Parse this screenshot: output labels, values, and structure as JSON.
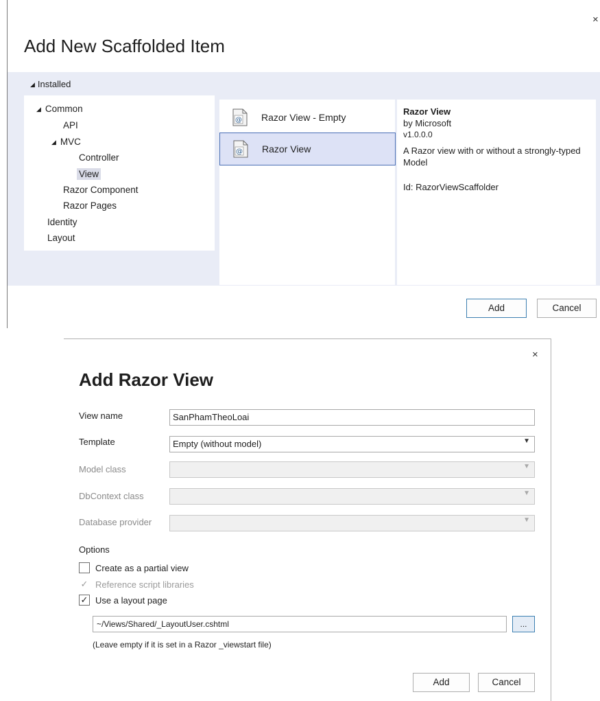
{
  "scaffold": {
    "title": "Add New Scaffolded Item",
    "installed_label": "Installed",
    "tree": [
      {
        "label": "Common"
      },
      {
        "label": "API"
      },
      {
        "label": "MVC"
      },
      {
        "label": "Controller"
      },
      {
        "label": "View"
      },
      {
        "label": "Razor Component"
      },
      {
        "label": "Razor Pages"
      },
      {
        "label": "Identity"
      },
      {
        "label": "Layout"
      }
    ],
    "templates": [
      {
        "label": "Razor View - Empty"
      },
      {
        "label": "Razor View"
      }
    ],
    "selected_tree": "View",
    "selected_template": "Razor View",
    "description": {
      "name": "Razor View",
      "author": "by Microsoft",
      "version": "v1.0.0.0",
      "text": "A Razor view with or without a strongly-typed Model",
      "id": "Id: RazorViewScaffolder"
    },
    "add_label": "Add",
    "cancel_label": "Cancel",
    "close_glyph": "×"
  },
  "razor_view": {
    "title": "Add Razor View",
    "close_glyph": "×",
    "view_name_label": "View name",
    "view_name_value": "SanPhamTheoLoai",
    "template_label": "Template",
    "template_value": "Empty (without model)",
    "model_class_label": "Model class",
    "dbcontext_label": "DbContext class",
    "db_provider_label": "Database provider",
    "options_label": "Options",
    "partial_label": "Create as a partial view",
    "partial_checked": false,
    "ref_scripts_label": "Reference script libraries",
    "ref_scripts_checked": true,
    "ref_scripts_disabled": true,
    "use_layout_label": "Use a layout page",
    "use_layout_checked": true,
    "layout_path": "~/Views/Shared/_LayoutUser.cshtml",
    "browse_label": "...",
    "hint": "(Leave empty if it is set in a Razor _viewstart file)",
    "add_label": "Add",
    "cancel_label": "Cancel"
  },
  "colors": {
    "band": "#e9ecf6",
    "selection": "#dde2f6",
    "selection_border": "#4a6fb5",
    "primary_border": "#3c7fb1"
  }
}
